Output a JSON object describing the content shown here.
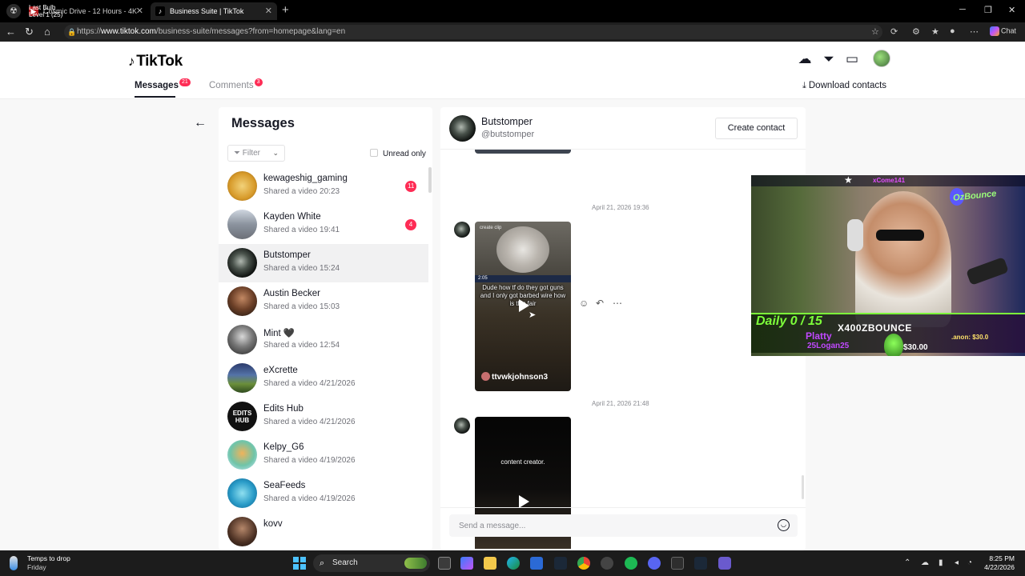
{
  "browser": {
    "tabs": [
      {
        "title": "Cosmic Drive - 12 Hours - 4K",
        "overlay_line1": "Last Bulb",
        "overlay_line2": "Level 1  (25)"
      },
      {
        "title": "Business Suite | TikTok"
      }
    ],
    "url_prefix": "https://",
    "url_domain": "www.tiktok.com",
    "url_rest": "/business-suite/messages?from=homepage&lang=en",
    "chat_label": "Chat"
  },
  "header": {
    "logo": "TikTok",
    "tabs": [
      {
        "label": "Messages",
        "badge": "21"
      },
      {
        "label": "Comments",
        "badge": "3"
      }
    ],
    "download_contacts": "Download contacts"
  },
  "messages_panel": {
    "title": "Messages",
    "filter_label": "Filter",
    "unread_only_label": "Unread only",
    "conversations": [
      {
        "name": "kewageshig_gaming",
        "subtitle": "Shared a video 20:23",
        "unread": "11"
      },
      {
        "name": "Kayden White",
        "subtitle": "Shared a video 19:41",
        "unread": "4"
      },
      {
        "name": "Butstomper",
        "subtitle": "Shared a video 15:24",
        "unread": ""
      },
      {
        "name": "Austin Becker",
        "subtitle": "Shared a video 15:03",
        "unread": ""
      },
      {
        "name": "Mint 🖤",
        "subtitle": "Shared a video 12:54",
        "unread": ""
      },
      {
        "name": "eXcrette",
        "subtitle": "Shared a video 4/21/2026",
        "unread": ""
      },
      {
        "name": "Edits Hub",
        "subtitle": "Shared a video 4/21/2026",
        "unread": ""
      },
      {
        "name": "Kelpy_G6",
        "subtitle": "Shared a video 4/19/2026",
        "unread": ""
      },
      {
        "name": "SeaFeeds",
        "subtitle": "Shared a video 4/19/2026",
        "unread": ""
      },
      {
        "name": "kovv",
        "subtitle": "",
        "unread": ""
      }
    ]
  },
  "chat": {
    "contact_name": "Butstomper",
    "contact_handle": "@butstomper",
    "create_contact_label": "Create contact",
    "timestamps": [
      "April 21, 2026 19:36",
      "April 21, 2026 21:48"
    ],
    "video1": {
      "tag": "create clip",
      "hud": "2:05",
      "caption": "Dude how tf do they got guns and I only got barbed wire how is this fair",
      "user": "ttvwkjohnson3"
    },
    "video2": {
      "caption": "content creator."
    },
    "composer_placeholder": "Send a message..."
  },
  "stream_overlay": {
    "top_text": "xCome141",
    "daily": "Daily 0 / 15",
    "sub_name": "X400ZBOUNCE",
    "platty": "Platty",
    "logan": "25Logan25",
    "amount": "$30.00",
    "anon": ".anon: $30.0",
    "neon_sign": "OzBounce"
  },
  "taskbar": {
    "weather_line1": "Temps to drop",
    "weather_line2": "Friday",
    "search_label": "Search",
    "time": "8:25 PM",
    "date": "4/22/2026"
  }
}
